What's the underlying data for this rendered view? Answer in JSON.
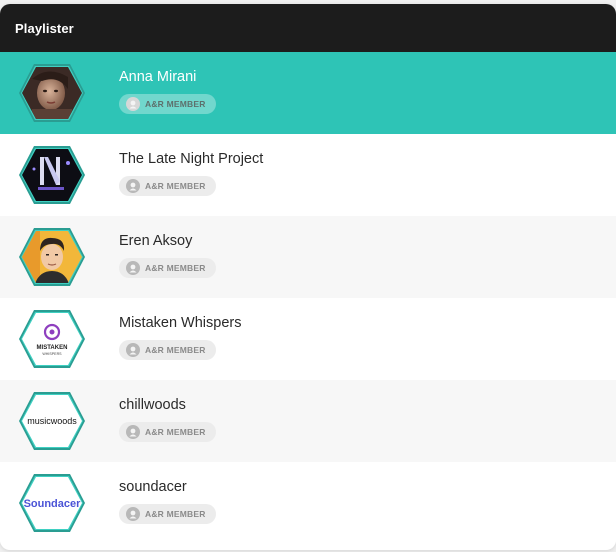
{
  "header": {
    "title": "Playlister"
  },
  "playlisters": [
    {
      "name": "Anna Mirani",
      "badge": "A&R MEMBER",
      "avatar_icon": "photo-portrait-woman"
    },
    {
      "name": "The Late Night Project",
      "badge": "A&R MEMBER",
      "avatar_icon": "night-logo"
    },
    {
      "name": "Eren Aksoy",
      "badge": "A&R MEMBER",
      "avatar_icon": "cartoon-man"
    },
    {
      "name": "Mistaken Whispers",
      "badge": "A&R MEMBER",
      "avatar_icon": "mistaken-whispers-logo",
      "logo_text": "MISTAKEN",
      "logo_subtext": "WHISPERS"
    },
    {
      "name": "chillwoods",
      "badge": "A&R MEMBER",
      "avatar_icon": "musicwoods-logo",
      "logo_text": "musicwoods"
    },
    {
      "name": "soundacer",
      "badge": "A&R MEMBER",
      "avatar_icon": "soundacer-logo",
      "logo_text": "Soundacer"
    }
  ],
  "colors": {
    "accent": "#2ec4b6",
    "header_bg": "#1c1c1c",
    "alt_row": "#f7f7f7"
  }
}
